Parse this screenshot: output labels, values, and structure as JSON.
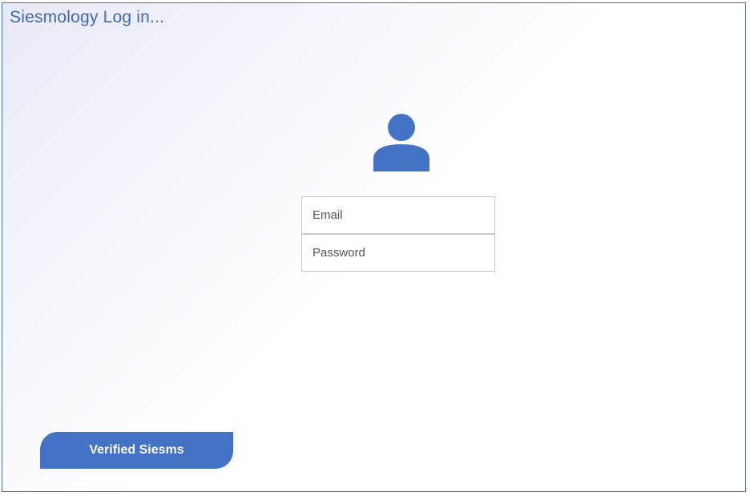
{
  "header": {
    "title": "Siesmology Log in..."
  },
  "login": {
    "avatar_icon": "user-icon",
    "email_placeholder": "Email",
    "email_value": "",
    "password_placeholder": "Password",
    "password_value": ""
  },
  "footer": {
    "verified_label": "Verified Siesms"
  },
  "colors": {
    "accent": "#4472c4",
    "title": "#3f68b6",
    "border": "#41719c"
  }
}
